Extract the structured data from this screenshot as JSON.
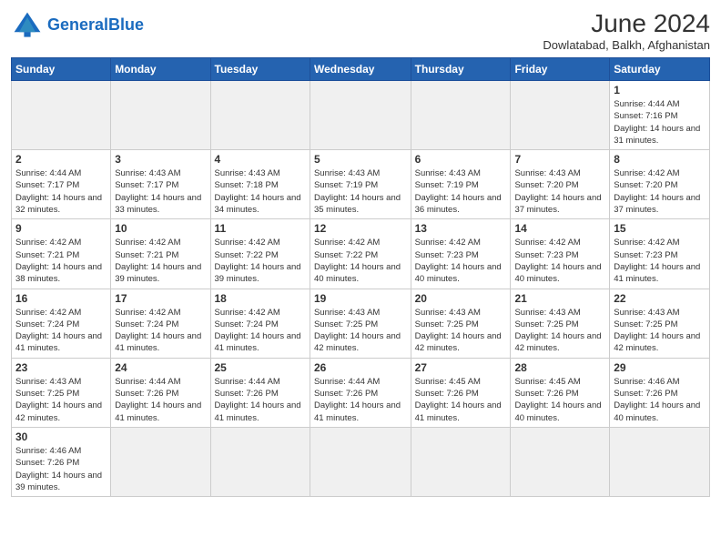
{
  "header": {
    "logo_general": "General",
    "logo_blue": "Blue",
    "month_title": "June 2024",
    "subtitle": "Dowlatabad, Balkh, Afghanistan"
  },
  "days_of_week": [
    "Sunday",
    "Monday",
    "Tuesday",
    "Wednesday",
    "Thursday",
    "Friday",
    "Saturday"
  ],
  "weeks": [
    [
      {
        "day": "",
        "info": ""
      },
      {
        "day": "",
        "info": ""
      },
      {
        "day": "",
        "info": ""
      },
      {
        "day": "",
        "info": ""
      },
      {
        "day": "",
        "info": ""
      },
      {
        "day": "",
        "info": ""
      },
      {
        "day": "1",
        "info": "Sunrise: 4:44 AM\nSunset: 7:16 PM\nDaylight: 14 hours and 31 minutes."
      }
    ],
    [
      {
        "day": "2",
        "info": "Sunrise: 4:44 AM\nSunset: 7:17 PM\nDaylight: 14 hours and 32 minutes."
      },
      {
        "day": "3",
        "info": "Sunrise: 4:43 AM\nSunset: 7:17 PM\nDaylight: 14 hours and 33 minutes."
      },
      {
        "day": "4",
        "info": "Sunrise: 4:43 AM\nSunset: 7:18 PM\nDaylight: 14 hours and 34 minutes."
      },
      {
        "day": "5",
        "info": "Sunrise: 4:43 AM\nSunset: 7:19 PM\nDaylight: 14 hours and 35 minutes."
      },
      {
        "day": "6",
        "info": "Sunrise: 4:43 AM\nSunset: 7:19 PM\nDaylight: 14 hours and 36 minutes."
      },
      {
        "day": "7",
        "info": "Sunrise: 4:43 AM\nSunset: 7:20 PM\nDaylight: 14 hours and 37 minutes."
      },
      {
        "day": "8",
        "info": "Sunrise: 4:42 AM\nSunset: 7:20 PM\nDaylight: 14 hours and 37 minutes."
      }
    ],
    [
      {
        "day": "9",
        "info": "Sunrise: 4:42 AM\nSunset: 7:21 PM\nDaylight: 14 hours and 38 minutes."
      },
      {
        "day": "10",
        "info": "Sunrise: 4:42 AM\nSunset: 7:21 PM\nDaylight: 14 hours and 39 minutes."
      },
      {
        "day": "11",
        "info": "Sunrise: 4:42 AM\nSunset: 7:22 PM\nDaylight: 14 hours and 39 minutes."
      },
      {
        "day": "12",
        "info": "Sunrise: 4:42 AM\nSunset: 7:22 PM\nDaylight: 14 hours and 40 minutes."
      },
      {
        "day": "13",
        "info": "Sunrise: 4:42 AM\nSunset: 7:23 PM\nDaylight: 14 hours and 40 minutes."
      },
      {
        "day": "14",
        "info": "Sunrise: 4:42 AM\nSunset: 7:23 PM\nDaylight: 14 hours and 40 minutes."
      },
      {
        "day": "15",
        "info": "Sunrise: 4:42 AM\nSunset: 7:23 PM\nDaylight: 14 hours and 41 minutes."
      }
    ],
    [
      {
        "day": "16",
        "info": "Sunrise: 4:42 AM\nSunset: 7:24 PM\nDaylight: 14 hours and 41 minutes."
      },
      {
        "day": "17",
        "info": "Sunrise: 4:42 AM\nSunset: 7:24 PM\nDaylight: 14 hours and 41 minutes."
      },
      {
        "day": "18",
        "info": "Sunrise: 4:42 AM\nSunset: 7:24 PM\nDaylight: 14 hours and 41 minutes."
      },
      {
        "day": "19",
        "info": "Sunrise: 4:43 AM\nSunset: 7:25 PM\nDaylight: 14 hours and 42 minutes."
      },
      {
        "day": "20",
        "info": "Sunrise: 4:43 AM\nSunset: 7:25 PM\nDaylight: 14 hours and 42 minutes."
      },
      {
        "day": "21",
        "info": "Sunrise: 4:43 AM\nSunset: 7:25 PM\nDaylight: 14 hours and 42 minutes."
      },
      {
        "day": "22",
        "info": "Sunrise: 4:43 AM\nSunset: 7:25 PM\nDaylight: 14 hours and 42 minutes."
      }
    ],
    [
      {
        "day": "23",
        "info": "Sunrise: 4:43 AM\nSunset: 7:25 PM\nDaylight: 14 hours and 42 minutes."
      },
      {
        "day": "24",
        "info": "Sunrise: 4:44 AM\nSunset: 7:26 PM\nDaylight: 14 hours and 41 minutes."
      },
      {
        "day": "25",
        "info": "Sunrise: 4:44 AM\nSunset: 7:26 PM\nDaylight: 14 hours and 41 minutes."
      },
      {
        "day": "26",
        "info": "Sunrise: 4:44 AM\nSunset: 7:26 PM\nDaylight: 14 hours and 41 minutes."
      },
      {
        "day": "27",
        "info": "Sunrise: 4:45 AM\nSunset: 7:26 PM\nDaylight: 14 hours and 41 minutes."
      },
      {
        "day": "28",
        "info": "Sunrise: 4:45 AM\nSunset: 7:26 PM\nDaylight: 14 hours and 40 minutes."
      },
      {
        "day": "29",
        "info": "Sunrise: 4:46 AM\nSunset: 7:26 PM\nDaylight: 14 hours and 40 minutes."
      }
    ],
    [
      {
        "day": "30",
        "info": "Sunrise: 4:46 AM\nSunset: 7:26 PM\nDaylight: 14 hours and 39 minutes."
      },
      {
        "day": "",
        "info": ""
      },
      {
        "day": "",
        "info": ""
      },
      {
        "day": "",
        "info": ""
      },
      {
        "day": "",
        "info": ""
      },
      {
        "day": "",
        "info": ""
      },
      {
        "day": "",
        "info": ""
      }
    ]
  ]
}
